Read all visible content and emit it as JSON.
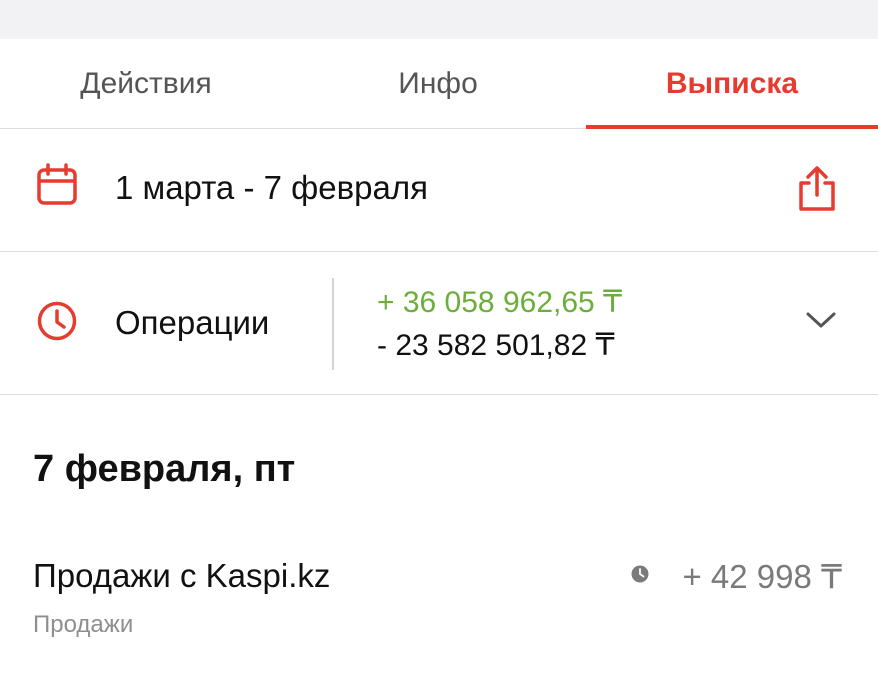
{
  "tabs": [
    {
      "label": "Действия",
      "active": false
    },
    {
      "label": "Инфо",
      "active": false
    },
    {
      "label": "Выписка",
      "active": true
    }
  ],
  "period": {
    "icon": "calendar-icon",
    "text": "1 марта - 7 февраля",
    "share_icon": "share-icon"
  },
  "operations": {
    "icon": "clock-icon",
    "label": "Операции",
    "income": "+ 36 058 962,65 ₸",
    "expense": "- 23 582 501,82 ₸",
    "expand_icon": "chevron-down-icon"
  },
  "transactions_group": {
    "date": "7 февраля, пт",
    "items": [
      {
        "title": "Продажи с Kaspi.kz",
        "category": "Продажи",
        "amount": "+ 42 998 ₸",
        "status_icon": "pending-clock-icon"
      }
    ]
  },
  "colors": {
    "accent": "#e63c30",
    "income": "#6cae3a",
    "muted": "#8e8e93"
  }
}
